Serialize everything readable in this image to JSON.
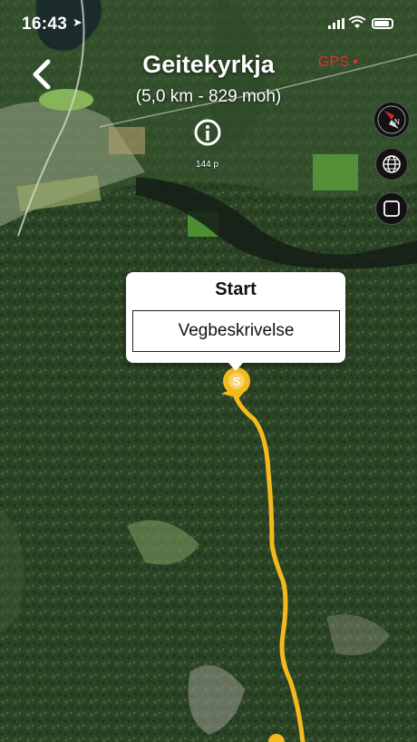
{
  "status_bar": {
    "time": "16:43",
    "location_icon": "location-arrow-icon",
    "signal_icon": "cellular-signal-icon",
    "wifi_icon": "wifi-icon",
    "battery_icon": "battery-icon"
  },
  "header": {
    "title": "Geitekyrkja",
    "subtitle": "(5,0 km - 829 moh)",
    "gps_label": "GPS",
    "back_icon": "chevron-left-icon",
    "info_icon": "info-icon"
  },
  "map": {
    "scale_label": "144 p",
    "route_color": "#f5b91e",
    "gps_color": "#e53030"
  },
  "controls": {
    "compass_icon": "compass-icon",
    "globe_icon": "globe-icon",
    "layer_icon": "square-icon"
  },
  "popup": {
    "title": "Start",
    "button_label": "Vegbeskrivelse"
  },
  "marker": {
    "label": "S"
  }
}
